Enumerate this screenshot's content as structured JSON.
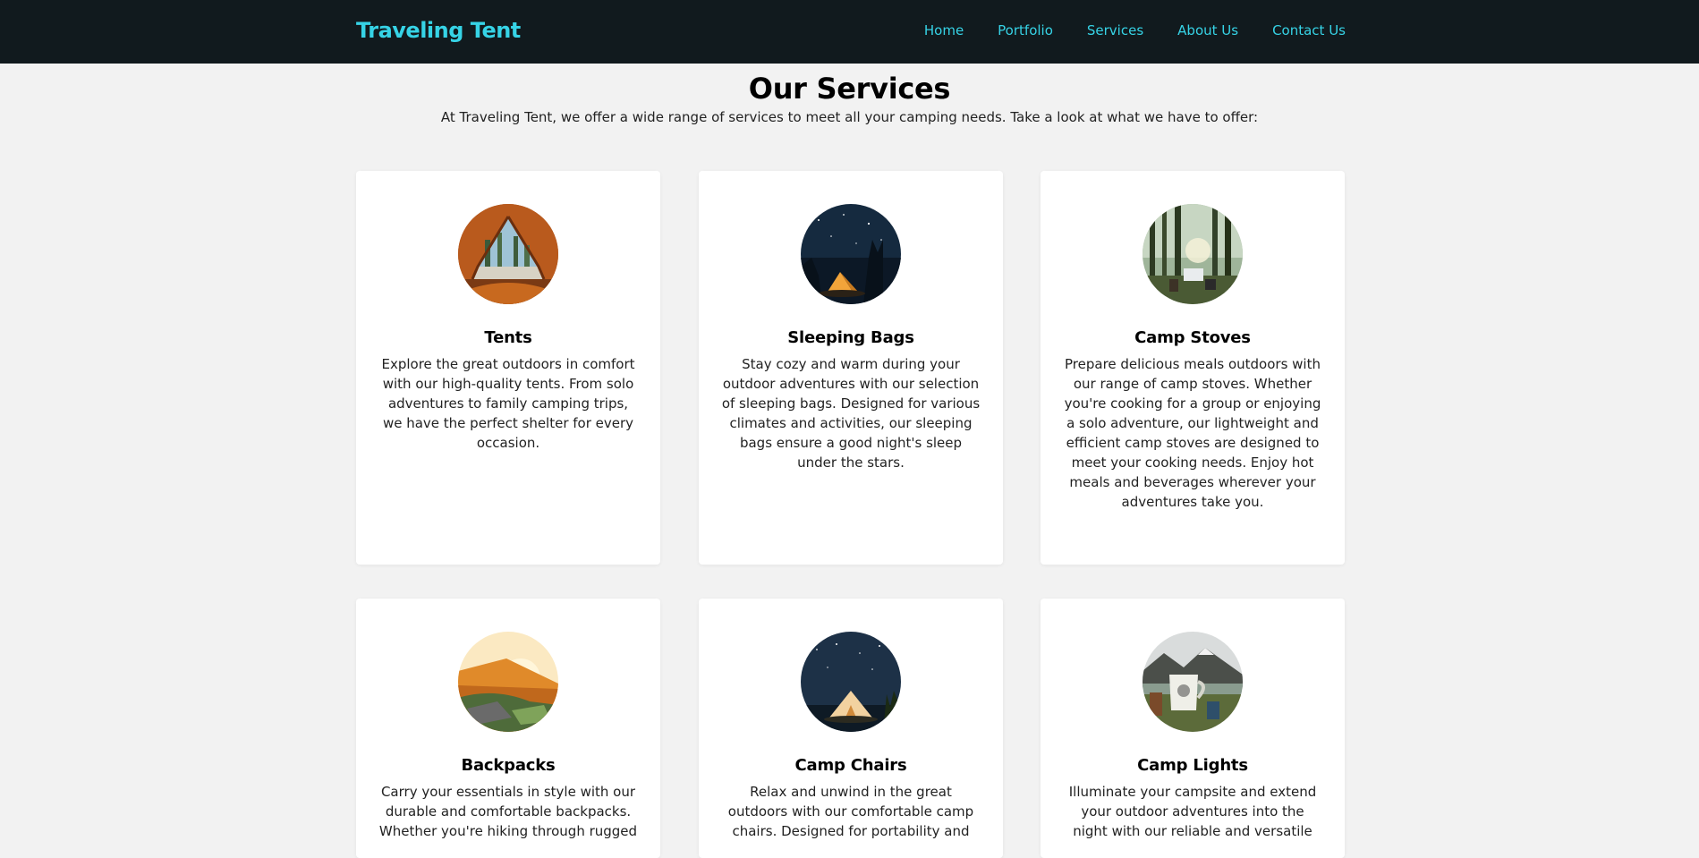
{
  "brand": "Traveling Tent",
  "nav": [
    "Home",
    "Portfolio",
    "Services",
    "About Us",
    "Contact Us"
  ],
  "page": {
    "title": "Our Services",
    "intro": "At Traveling Tent, we offer a wide range of services to meet all your camping needs. Take a look at what we have to offer:"
  },
  "services": [
    {
      "title": "Tents",
      "description": "Explore the great outdoors in comfort with our high-quality tents. From solo adventures to family camping trips, we have the perfect shelter for every occasion.",
      "image": "tent-interior-forest-photo"
    },
    {
      "title": "Sleeping Bags",
      "description": "Stay cozy and warm during your outdoor adventures with our selection of sleeping bags. Designed for various climates and activities, our sleeping bags ensure a good night's sleep under the stars.",
      "image": "tent-night-sky-photo"
    },
    {
      "title": "Camp Stoves",
      "description": "Prepare delicious meals outdoors with our range of camp stoves. Whether you're cooking for a group or enjoying a solo adventure, our lightweight and efficient camp stoves are designed to meet your cooking needs. Enjoy hot meals and beverages wherever your adventures take you.",
      "image": "forest-campsite-photo"
    },
    {
      "title": "Backpacks",
      "description": "Carry your essentials in style with our durable and comfortable backpacks. Whether you're hiking through rugged",
      "image": "sunset-tent-photo"
    },
    {
      "title": "Camp Chairs",
      "description": "Relax and unwind in the great outdoors with our comfortable camp chairs. Designed for portability and",
      "image": "glowing-tent-night-photo"
    },
    {
      "title": "Camp Lights",
      "description": "Illuminate your campsite and extend your outdoor adventures into the night with our reliable and versatile",
      "image": "camping-mug-mountains-photo"
    }
  ],
  "colors": {
    "navbar_bg": "#111a1e",
    "accent": "#36d3e6",
    "page_bg": "#f2f2f2",
    "card_bg": "#ffffff"
  }
}
